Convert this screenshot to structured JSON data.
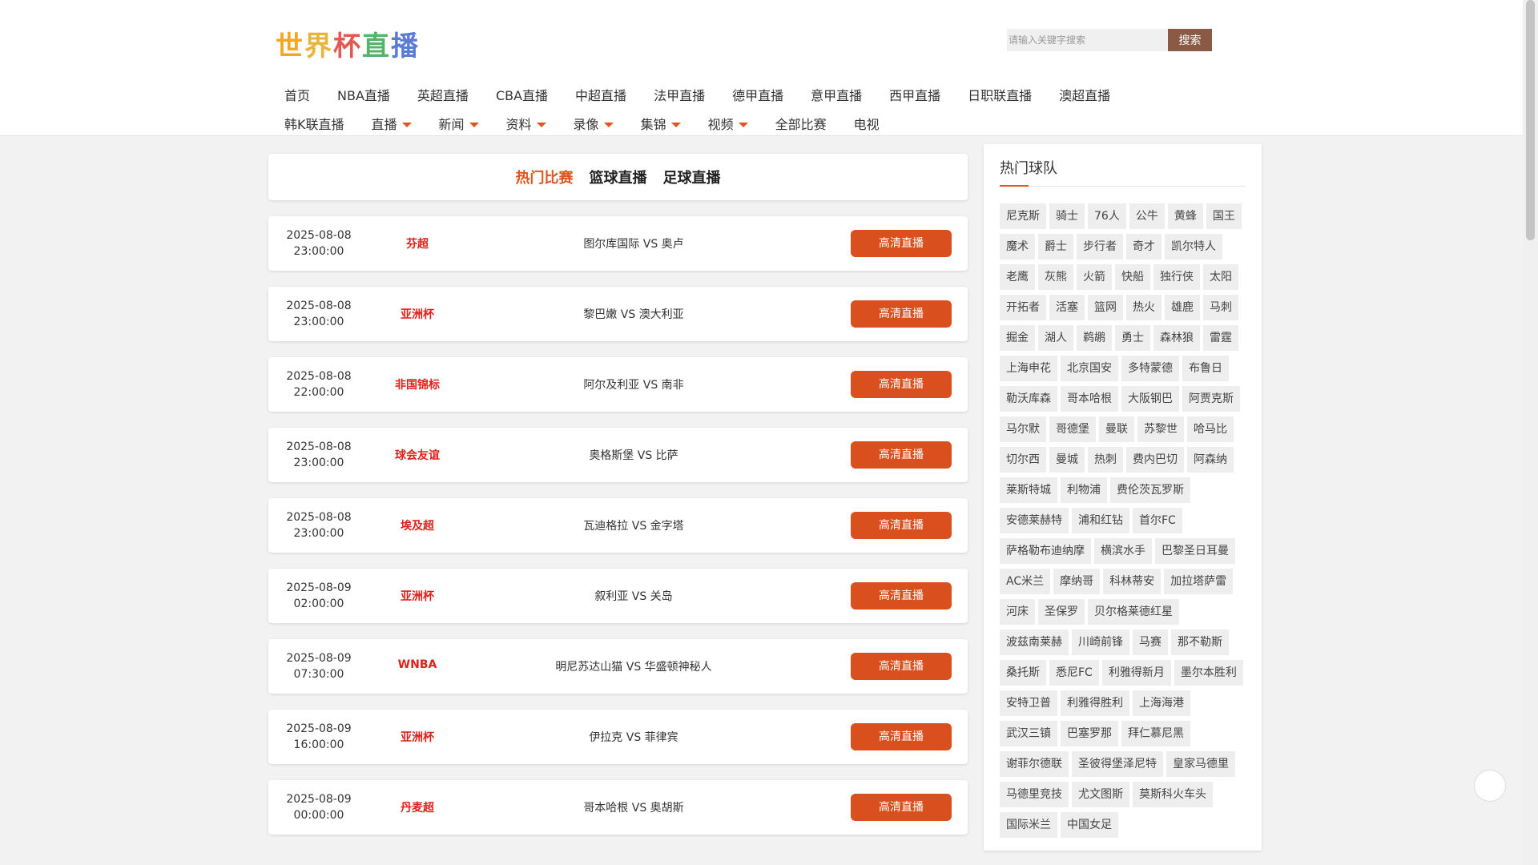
{
  "logo": {
    "chars": [
      "世",
      "界",
      "杯",
      "直",
      "播"
    ]
  },
  "search": {
    "placeholder": "请输入关键字搜索",
    "button": "搜索"
  },
  "nav": {
    "row1": [
      "首页",
      "NBA直播",
      "英超直播",
      "CBA直播",
      "中超直播",
      "法甲直播",
      "德甲直播",
      "意甲直播",
      "西甲直播",
      "日职联直播",
      "澳超直播"
    ],
    "row2": [
      {
        "label": "韩K联直播",
        "dropdown": false
      },
      {
        "label": "直播",
        "dropdown": true
      },
      {
        "label": "新闻",
        "dropdown": true
      },
      {
        "label": "资料",
        "dropdown": true
      },
      {
        "label": "录像",
        "dropdown": true
      },
      {
        "label": "集锦",
        "dropdown": true
      },
      {
        "label": "视频",
        "dropdown": true
      },
      {
        "label": "全部比赛",
        "dropdown": false
      },
      {
        "label": "电视",
        "dropdown": false
      }
    ]
  },
  "tabs": [
    "热门比赛",
    "篮球直播",
    "足球直播"
  ],
  "matches": [
    {
      "date": "2025-08-08",
      "time": "23:00:00",
      "league": "芬超",
      "teams": "图尔库国际 VS 奥卢",
      "button": "高清直播"
    },
    {
      "date": "2025-08-08",
      "time": "23:00:00",
      "league": "亚洲杯",
      "teams": "黎巴嫩 VS 澳大利亚",
      "button": "高清直播"
    },
    {
      "date": "2025-08-08",
      "time": "22:00:00",
      "league": "非国锦标",
      "teams": "阿尔及利亚 VS 南非",
      "button": "高清直播"
    },
    {
      "date": "2025-08-08",
      "time": "23:00:00",
      "league": "球会友谊",
      "teams": "奥格斯堡 VS 比萨",
      "button": "高清直播"
    },
    {
      "date": "2025-08-08",
      "time": "23:00:00",
      "league": "埃及超",
      "teams": "瓦迪格拉 VS 金字塔",
      "button": "高清直播"
    },
    {
      "date": "2025-08-09",
      "time": "02:00:00",
      "league": "亚洲杯",
      "teams": "叙利亚 VS 关岛",
      "button": "高清直播"
    },
    {
      "date": "2025-08-09",
      "time": "07:30:00",
      "league": "WNBA",
      "teams": "明尼苏达山猫 VS 华盛顿神秘人",
      "button": "高清直播"
    },
    {
      "date": "2025-08-09",
      "time": "16:00:00",
      "league": "亚洲杯",
      "teams": "伊拉克 VS 菲律宾",
      "button": "高清直播"
    },
    {
      "date": "2025-08-09",
      "time": "00:00:00",
      "league": "丹麦超",
      "teams": "哥本哈根 VS 奥胡斯",
      "button": "高清直播"
    }
  ],
  "sidebar": {
    "title": "热门球队",
    "teams": [
      "尼克斯",
      "骑士",
      "76人",
      "公牛",
      "黄蜂",
      "国王",
      "魔术",
      "爵士",
      "步行者",
      "奇才",
      "凯尔特人",
      "老鹰",
      "灰熊",
      "火箭",
      "快船",
      "独行侠",
      "太阳",
      "开拓者",
      "活塞",
      "篮网",
      "热火",
      "雄鹿",
      "马刺",
      "掘金",
      "湖人",
      "鹈鹕",
      "勇士",
      "森林狼",
      "雷霆",
      "上海申花",
      "北京国安",
      "多特蒙德",
      "布鲁日",
      "勒沃库森",
      "哥本哈根",
      "大阪钢巴",
      "阿贾克斯",
      "马尔默",
      "哥德堡",
      "曼联",
      "苏黎世",
      "哈马比",
      "切尔西",
      "曼城",
      "热刺",
      "费内巴切",
      "阿森纳",
      "莱斯特城",
      "利物浦",
      "费伦茨瓦罗斯",
      "安德莱赫特",
      "浦和红钻",
      "首尔FC",
      "萨格勒布迪纳摩",
      "横滨水手",
      "巴黎圣日耳曼",
      "AC米兰",
      "摩纳哥",
      "科林蒂安",
      "加拉塔萨雷",
      "河床",
      "圣保罗",
      "贝尔格莱德红星",
      "波兹南莱赫",
      "川崎前锋",
      "马赛",
      "那不勒斯",
      "桑托斯",
      "悉尼FC",
      "利雅得新月",
      "墨尔本胜利",
      "安特卫普",
      "利雅得胜利",
      "上海海港",
      "武汉三镇",
      "巴塞罗那",
      "拜仁慕尼黑",
      "谢菲尔德联",
      "圣彼得堡泽尼特",
      "皇家马德里",
      "马德里竞技",
      "尤文图斯",
      "莫斯科火车头",
      "国际米兰",
      "中国女足"
    ]
  },
  "colors": {
    "accent": "#e2541f",
    "button": "#d9501e",
    "league": "#e0201a",
    "search_button": "#8b5a45"
  }
}
